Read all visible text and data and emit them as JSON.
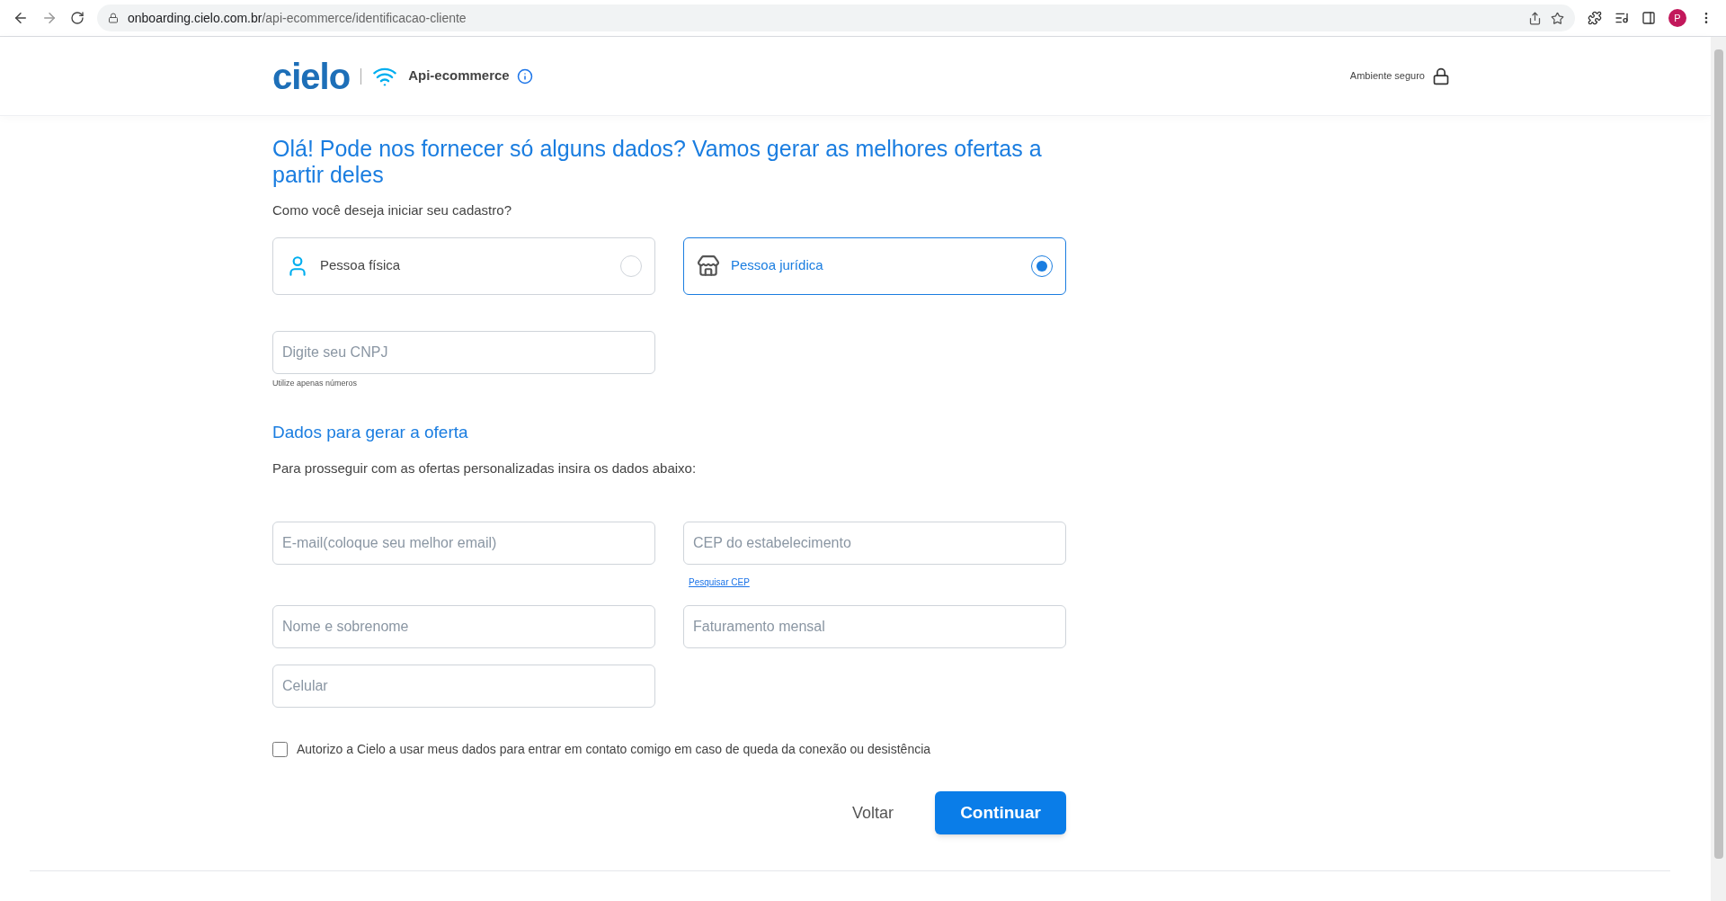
{
  "browser": {
    "url_host": "onboarding.cielo.com.br",
    "url_path": "/api-ecommerce/identificacao-cliente",
    "profile_initial": "P"
  },
  "header": {
    "logo": "cielo",
    "product": "Api-ecommerce",
    "secure_label": "Ambiente seguro"
  },
  "title": "Olá! Pode nos fornecer só alguns dados? Vamos gerar as melhores ofertas a partir deles",
  "question": "Como você deseja iniciar seu cadastro?",
  "person_types": [
    {
      "label": "Pessoa física",
      "kind": "person",
      "selected": false
    },
    {
      "label": "Pessoa jurídica",
      "kind": "store",
      "selected": true
    }
  ],
  "cnpj": {
    "placeholder": "Digite seu CNPJ",
    "hint": "Utilize apenas números"
  },
  "offer_section": {
    "heading": "Dados para gerar a oferta",
    "description": "Para prosseguir com as ofertas personalizadas insira os dados abaixo:"
  },
  "fields": [
    {
      "placeholder": "E-mail(coloque seu melhor email)"
    },
    {
      "placeholder": "CEP do estabelecimento",
      "link": "Pesquisar CEP"
    },
    {
      "placeholder": "Nome e sobrenome"
    },
    {
      "placeholder": "Faturamento mensal"
    },
    {
      "placeholder": "Celular"
    }
  ],
  "consent": {
    "label": "Autorizo a Cielo a usar meus dados para entrar em contato comigo em caso de queda da conexão ou desistência",
    "checked": false
  },
  "buttons": {
    "back": "Voltar",
    "continue": "Continuar"
  }
}
